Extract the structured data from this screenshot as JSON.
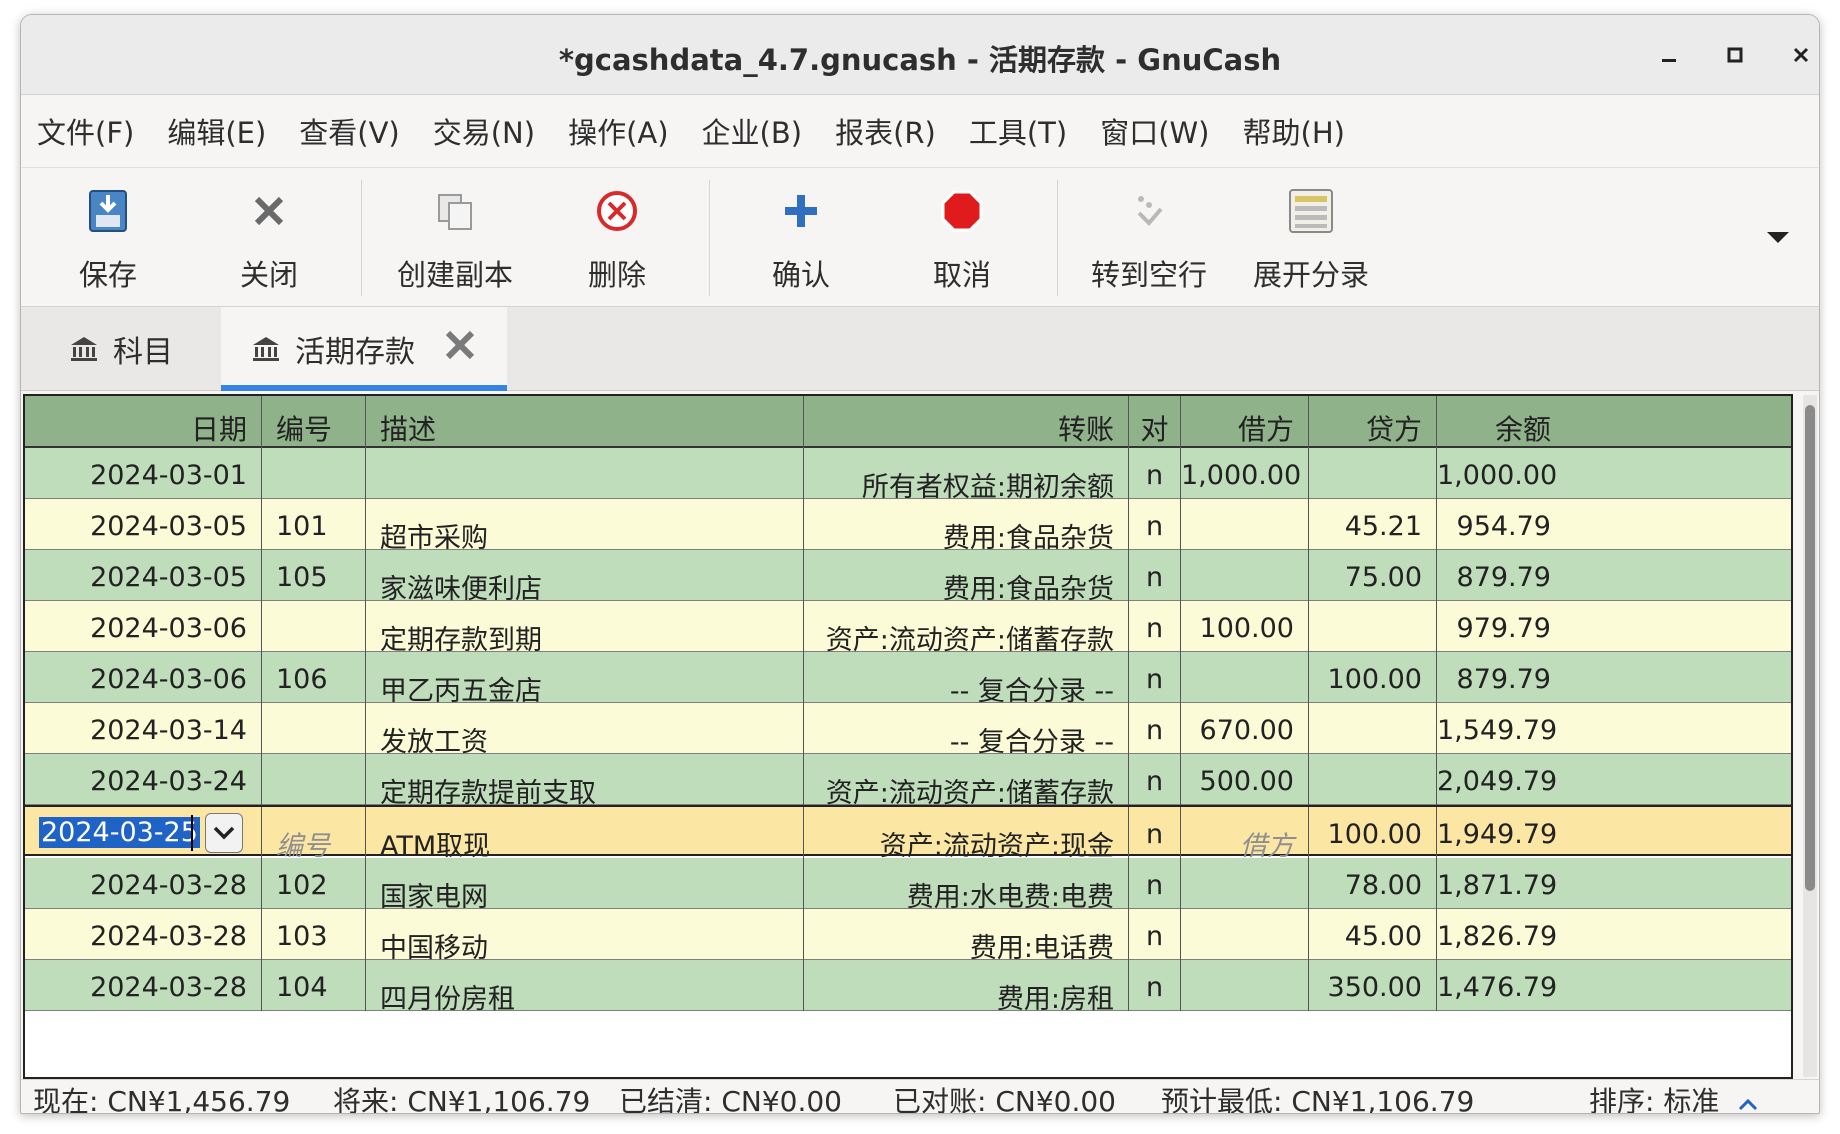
{
  "window": {
    "title": "*gcashdata_4.7.gnucash - 活期存款 - GnuCash"
  },
  "menu": [
    "文件(F)",
    "编辑(E)",
    "查看(V)",
    "交易(N)",
    "操作(A)",
    "企业(B)",
    "报表(R)",
    "工具(T)",
    "窗口(W)",
    "帮助(H)"
  ],
  "toolbar": {
    "save": "保存",
    "close": "关闭",
    "duplicate": "创建副本",
    "delete": "删除",
    "enter": "确认",
    "cancel": "取消",
    "blank": "转到空行",
    "split": "展开分录"
  },
  "tabs": {
    "accounts": "科目",
    "register": "活期存款"
  },
  "register": {
    "headers": {
      "date": "日期",
      "num": "编号",
      "desc": "描述",
      "transfer": "转账",
      "r": "对",
      "debit": "借方",
      "credit": "贷方",
      "balance": "余额"
    },
    "rows": [
      {
        "date": "2024-03-01",
        "num": "",
        "desc": "",
        "transfer": "所有者权益:期初余额",
        "r": "n",
        "debit": "1,000.00",
        "credit": "",
        "balance": "1,000.00"
      },
      {
        "date": "2024-03-05",
        "num": "101",
        "desc": "超市采购",
        "transfer": "费用:食品杂货",
        "r": "n",
        "debit": "",
        "credit": "45.21",
        "balance": "954.79"
      },
      {
        "date": "2024-03-05",
        "num": "105",
        "desc": "家滋味便利店",
        "transfer": "费用:食品杂货",
        "r": "n",
        "debit": "",
        "credit": "75.00",
        "balance": "879.79"
      },
      {
        "date": "2024-03-06",
        "num": "",
        "desc": "定期存款到期",
        "transfer": "资产:流动资产:储蓄存款",
        "r": "n",
        "debit": "100.00",
        "credit": "",
        "balance": "979.79"
      },
      {
        "date": "2024-03-06",
        "num": "106",
        "desc": "甲乙丙五金店",
        "transfer": "-- 复合分录 --",
        "r": "n",
        "debit": "",
        "credit": "100.00",
        "balance": "879.79"
      },
      {
        "date": "2024-03-14",
        "num": "",
        "desc": "发放工资",
        "transfer": "-- 复合分录 --",
        "r": "n",
        "debit": "670.00",
        "credit": "",
        "balance": "1,549.79"
      },
      {
        "date": "2024-03-24",
        "num": "",
        "desc": "定期存款提前支取",
        "transfer": "资产:流动资产:储蓄存款",
        "r": "n",
        "debit": "500.00",
        "credit": "",
        "balance": "2,049.79"
      }
    ],
    "current": {
      "date": "2024-03-25",
      "num_placeholder": "编号",
      "desc": "ATM取现",
      "transfer": "资产:流动资产:现金",
      "r": "n",
      "debit_placeholder": "借方",
      "credit": "100.00",
      "balance": "1,949.79"
    },
    "rows_after": [
      {
        "date": "2024-03-28",
        "num": "102",
        "desc": "国家电网",
        "transfer": "费用:水电费:电费",
        "r": "n",
        "debit": "",
        "credit": "78.00",
        "balance": "1,871.79"
      },
      {
        "date": "2024-03-28",
        "num": "103",
        "desc": "中国移动",
        "transfer": "费用:电话费",
        "r": "n",
        "debit": "",
        "credit": "45.00",
        "balance": "1,826.79"
      },
      {
        "date": "2024-03-28",
        "num": "104",
        "desc": "四月份房租",
        "transfer": "费用:房租",
        "r": "n",
        "debit": "",
        "credit": "350.00",
        "balance": "1,476.79"
      }
    ]
  },
  "status": {
    "present": "现在: CN¥1,456.79",
    "future": "将来: CN¥1,106.79",
    "cleared": "已结清: CN¥0.00",
    "reconciled": "已对账: CN¥0.00",
    "projected_min": "预计最低: CN¥1,106.79",
    "sort": "排序: 标准"
  }
}
